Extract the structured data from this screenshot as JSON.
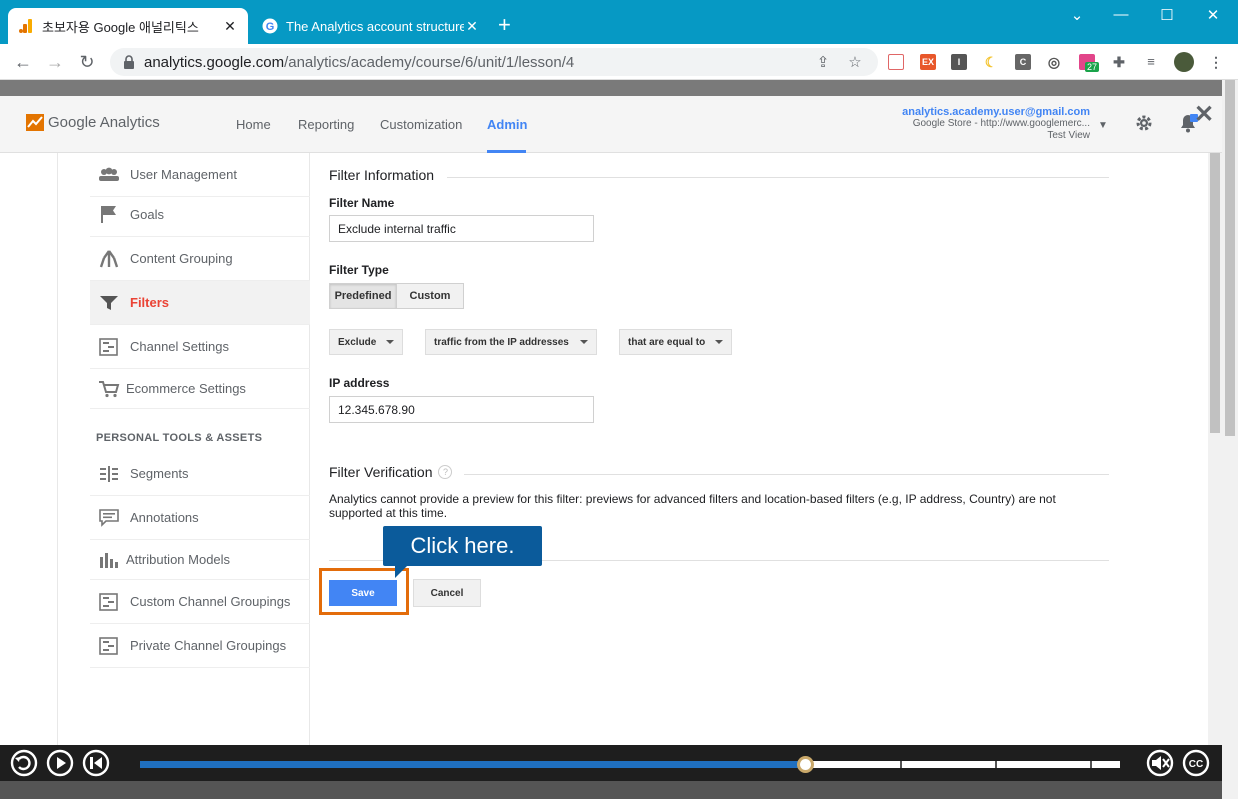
{
  "browser": {
    "tabs": [
      {
        "title": "초보자용 Google 애널리틱스",
        "active": true
      },
      {
        "title": "The Analytics account structure",
        "active": false
      }
    ],
    "url_host": "analytics.google.com",
    "url_path": "/analytics/academy/course/6/unit/1/lesson/4",
    "extension_badge": "27"
  },
  "ga": {
    "logo_text": "Google Analytics",
    "nav": [
      "Home",
      "Reporting",
      "Customization",
      "Admin"
    ],
    "active_nav": "Admin",
    "account_email": "analytics.academy.user@gmail.com",
    "account_property": "Google Store - http://www.googlemerc...",
    "account_view": "Test View"
  },
  "sidebar": {
    "items": [
      {
        "label": "User Management",
        "icon": "users-icon"
      },
      {
        "label": "Goals",
        "icon": "flag-icon"
      },
      {
        "label": "Content Grouping",
        "icon": "grouping-icon"
      },
      {
        "label": "Filters",
        "icon": "filter-icon",
        "active": true
      },
      {
        "label": "Channel Settings",
        "icon": "channel-icon"
      },
      {
        "label": "Ecommerce Settings",
        "icon": "cart-icon"
      }
    ],
    "section_title": "PERSONAL TOOLS & ASSETS",
    "personal_items": [
      {
        "label": "Segments",
        "icon": "segments-icon"
      },
      {
        "label": "Annotations",
        "icon": "annotation-icon"
      },
      {
        "label": "Attribution Models",
        "icon": "bar-chart-icon"
      },
      {
        "label": "Custom Channel Groupings",
        "icon": "channel-icon"
      },
      {
        "label": "Private Channel Groupings",
        "icon": "channel-icon"
      }
    ]
  },
  "form": {
    "filter_information_title": "Filter Information",
    "filter_name_label": "Filter Name",
    "filter_name_value": "Exclude internal traffic",
    "filter_type_label": "Filter Type",
    "type_predefined": "Predefined",
    "type_custom": "Custom",
    "dropdown_action": "Exclude",
    "dropdown_source": "traffic from the IP addresses",
    "dropdown_expression": "that are equal to",
    "ip_label": "IP address",
    "ip_value": "12.345.678.90",
    "verification_title": "Filter Verification",
    "verification_text": "Analytics cannot provide a preview for this filter: previews for advanced filters and location-based filters (e.g, IP address, Country) are not supported at this time.",
    "save_label": "Save",
    "cancel_label": "Cancel"
  },
  "tutorial": {
    "callout_text": "Click here."
  },
  "player": {
    "progress": 0.68,
    "colors": {
      "fill": "#1f6fbf",
      "knob": "#c9a86a"
    }
  },
  "colors": {
    "tabbar": "#0699c4",
    "accent": "#4285f4",
    "active_sidebar": "#ea4335",
    "highlight": "#e36c0a",
    "callout": "#0b5b9b"
  }
}
